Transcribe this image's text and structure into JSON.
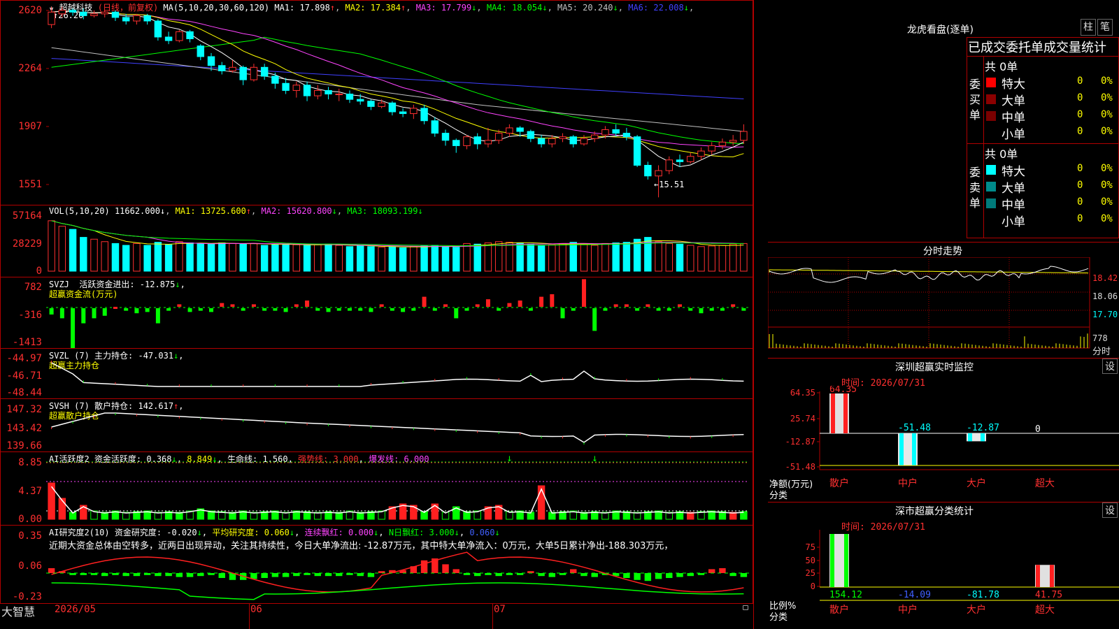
{
  "stock": {
    "name": "超越科技",
    "mode": "(日线，前复权)",
    "star": "★"
  },
  "main_ma": {
    "label": "MA(5,10,20,30,60,120)",
    "items": [
      {
        "label": "MA1: 17.898",
        "arrow": "↑",
        "color": "#ffffff"
      },
      {
        "label": "MA2: 17.384",
        "arrow": "↑",
        "color": "#ffff00"
      },
      {
        "label": "MA3: 17.799",
        "arrow": "↓",
        "color": "#ff44ff"
      },
      {
        "label": "MA4: 18.054",
        "arrow": "↓",
        "color": "#00ff00"
      },
      {
        "label": "MA5: 20.240",
        "arrow": "↓",
        "color": "#c0c0c0"
      },
      {
        "label": "MA6: 22.008",
        "arrow": "↓",
        "color": "#4040ff"
      }
    ],
    "high_mark": "↑26.20",
    "low_mark": "←15.51",
    "yticks": [
      "2620",
      "2264",
      "1907",
      "1551"
    ]
  },
  "vol": {
    "label": "VOL(5,10,20)",
    "value": "11662.000",
    "arrow": "↓",
    "ma1": "MA1: 13725.600",
    "ma1_arrow": "↑",
    "ma2": "MA2: 15620.800",
    "ma2_arrow": "↓",
    "ma3": "MA3: 18093.199",
    "ma3_arrow": "↓",
    "yticks": [
      "57164",
      "28229",
      "0"
    ]
  },
  "svzj": {
    "label": "SVZJ",
    "name": "活跃资金进出: -12.875",
    "arrow": "↓",
    "sub": "超赢资金流(万元)",
    "yticks": [
      "782",
      "-316",
      "-1413"
    ]
  },
  "svzl": {
    "label": "SVZL (7)",
    "name": "主力持仓: -47.031",
    "arrow": "↓",
    "sub": "超赢主力持仓",
    "yticks": [
      "-44.97",
      "-46.71",
      "-48.44"
    ]
  },
  "svsh": {
    "label": "SVSH (7)",
    "name": "散户持仓: 142.617",
    "arrow": "↑",
    "sub": "超赢散户持仓",
    "yticks": [
      "147.32",
      "143.42",
      "139.66"
    ]
  },
  "ai1": {
    "label": "AI活跃度2",
    "v1": "资金活跃度: 0.368",
    "v1a": "↓",
    "v2": "8.849",
    "v2a": "↓",
    "v3": "生命线: 1.560",
    "v4": "强势线: 3.000",
    "v5": "爆发线: 6.000",
    "yticks": [
      "8.85",
      "4.37",
      "0.00"
    ]
  },
  "ai2": {
    "label": "AI研究度2(10)",
    "v1": "资金研究度: -0.020",
    "v1a": "↓",
    "v2": "平均研究度: 0.060",
    "v2a": "↓",
    "v3": "连续飘红: 0.000",
    "v3a": "↓",
    "v4": "N日飘红: 3.000",
    "v4a": "↓",
    "v5": "0.060",
    "v5a": "↓",
    "desc": "近期大资金总体由空转多，近两日出现异动，关注其持续性，今日大单净流出: -12.87万元，其中特大单净流入：0万元，大单5日累计净出-188.303万元，",
    "yticks": [
      "0.35",
      "0.06",
      "-0.23"
    ]
  },
  "bottom": {
    "brand": "大智慧",
    "dates": [
      "2026/05",
      "06",
      "07"
    ]
  },
  "longhu": {
    "title": "龙虎看盘(逐单)",
    "btn1": "柱",
    "btn2": "笔",
    "header": "已成交委托单成交量统计",
    "buy_label": "委买单",
    "sell_label": "委卖单",
    "buy_total": "共 0单",
    "sell_total": "共 0单",
    "buy_rows": [
      {
        "name": "特大",
        "count": "0",
        "pct": "0%",
        "color": "#ff0000"
      },
      {
        "name": "大单",
        "count": "0",
        "pct": "0%",
        "color": "#8b0000"
      },
      {
        "name": "中单",
        "count": "0",
        "pct": "0%",
        "color": "#7a0000"
      },
      {
        "name": "小单",
        "count": "0",
        "pct": "0%",
        "color": "#000000"
      }
    ],
    "sell_rows": [
      {
        "name": "特大",
        "count": "0",
        "pct": "0%",
        "color": "#00ffff"
      },
      {
        "name": "大单",
        "count": "0",
        "pct": "0%",
        "color": "#008b8b"
      },
      {
        "name": "中单",
        "count": "0",
        "pct": "0%",
        "color": "#007a7a"
      },
      {
        "name": "小单",
        "count": "0",
        "pct": "0%",
        "color": "#000000"
      }
    ]
  },
  "fenshi": {
    "title": "分时走势",
    "p1": "18.42",
    "p2": "18.06",
    "p3": "17.70",
    "vol": "778",
    "vol_label": "分时"
  },
  "sz_monitor": {
    "title": "深圳超赢实时监控",
    "btn": "设",
    "time": "时间: 2026/07/31",
    "yticks": [
      "64.35",
      "25.74",
      "-12.87",
      "-51.48"
    ],
    "ylabel1": "净额(万元)",
    "ylabel2": "分类",
    "categories": [
      "散户",
      "中户",
      "大户",
      "超大"
    ],
    "values": [
      64.35,
      -51.48,
      -12.87,
      0
    ],
    "value_labels": [
      "64.35",
      "-51.48",
      "-12.87",
      "0"
    ]
  },
  "sz_class": {
    "title": "深市超赢分类统计",
    "btn": "设",
    "time": "时间: 2026/07/31",
    "yticks": [
      "75",
      "50",
      "25",
      "0"
    ],
    "ylabel1": "比例%",
    "ylabel2": "分类",
    "categories": [
      "散户",
      "中户",
      "大户",
      "超大"
    ],
    "values": [
      154.12,
      -14.09,
      -81.78,
      41.75
    ],
    "value_labels": [
      "154.12",
      "-14.09",
      "-81.78",
      "41.75"
    ]
  },
  "chart_data": {
    "type": "candlestick",
    "ylim": [
      15.2,
      26.5
    ],
    "candles": [
      [
        25.2,
        25.9,
        26.2,
        25.0
      ],
      [
        25.8,
        26.0,
        26.2,
        25.6
      ],
      [
        26.0,
        25.9,
        26.1,
        25.7
      ],
      [
        25.9,
        25.7,
        26.1,
        25.5
      ],
      [
        25.7,
        25.8,
        26.0,
        25.6
      ],
      [
        25.8,
        25.9,
        26.0,
        25.6
      ],
      [
        25.9,
        25.6,
        26.0,
        25.4
      ],
      [
        25.6,
        25.4,
        25.8,
        25.2
      ],
      [
        25.4,
        25.7,
        25.8,
        25.2
      ],
      [
        25.7,
        25.4,
        25.8,
        25.2
      ],
      [
        25.4,
        24.5,
        25.5,
        24.3
      ],
      [
        24.5,
        24.3,
        24.8,
        24.1
      ],
      [
        24.3,
        24.8,
        24.9,
        24.2
      ],
      [
        24.8,
        24.4,
        24.9,
        24.2
      ],
      [
        24.0,
        23.4,
        24.1,
        23.2
      ],
      [
        23.4,
        22.9,
        23.6,
        22.6
      ],
      [
        22.9,
        22.6,
        23.1,
        22.4
      ],
      [
        22.6,
        22.8,
        23.2,
        22.5
      ],
      [
        22.8,
        22.1,
        22.9,
        21.8
      ],
      [
        22.1,
        22.8,
        23.0,
        22.0
      ],
      [
        22.8,
        22.3,
        23.0,
        22.1
      ],
      [
        22.3,
        21.9,
        22.5,
        21.6
      ],
      [
        21.9,
        21.5,
        22.2,
        21.3
      ],
      [
        21.5,
        21.8,
        22.0,
        21.1
      ],
      [
        21.8,
        21.2,
        22.0,
        20.9
      ],
      [
        21.2,
        21.5,
        21.8,
        21.0
      ],
      [
        21.5,
        21.3,
        21.7,
        21.0
      ],
      [
        21.3,
        21.3,
        21.6,
        20.9
      ],
      [
        21.3,
        21.0,
        21.5,
        20.8
      ],
      [
        21.0,
        20.9,
        21.3,
        20.7
      ],
      [
        20.9,
        20.6,
        21.0,
        20.4
      ],
      [
        20.6,
        20.8,
        21.0,
        20.5
      ],
      [
        20.8,
        20.3,
        20.9,
        20.1
      ],
      [
        20.3,
        20.2,
        20.5,
        20.0
      ],
      [
        20.2,
        20.5,
        20.7,
        19.9
      ],
      [
        20.5,
        19.8,
        20.7,
        19.6
      ],
      [
        19.8,
        19.1,
        20.0,
        18.9
      ],
      [
        19.1,
        18.7,
        19.3,
        18.4
      ],
      [
        18.7,
        18.4,
        18.8,
        18.0
      ],
      [
        18.4,
        18.9,
        19.0,
        18.2
      ],
      [
        18.9,
        18.5,
        19.1,
        18.2
      ],
      [
        18.5,
        18.7,
        19.4,
        18.3
      ],
      [
        18.7,
        19.1,
        19.3,
        18.5
      ],
      [
        19.1,
        19.4,
        19.6,
        18.9
      ],
      [
        19.4,
        19.2,
        19.5,
        18.9
      ],
      [
        19.2,
        18.8,
        19.3,
        18.6
      ],
      [
        18.8,
        18.5,
        19.0,
        18.3
      ],
      [
        18.5,
        18.8,
        19.0,
        18.3
      ],
      [
        18.8,
        18.9,
        19.1,
        18.6
      ],
      [
        18.9,
        18.5,
        19.0,
        18.3
      ],
      [
        18.5,
        18.8,
        19.0,
        18.4
      ],
      [
        18.8,
        19.0,
        19.2,
        18.6
      ],
      [
        19.0,
        19.3,
        19.5,
        18.8
      ],
      [
        19.3,
        19.1,
        19.6,
        18.9
      ],
      [
        19.1,
        18.9,
        19.4,
        18.7
      ],
      [
        18.9,
        17.3,
        19.0,
        17.2
      ],
      [
        17.3,
        16.7,
        17.5,
        16.5
      ],
      [
        16.7,
        17.0,
        17.3,
        15.5
      ],
      [
        17.0,
        17.6,
        17.8,
        16.8
      ],
      [
        17.6,
        17.5,
        17.9,
        17.2
      ],
      [
        17.5,
        17.8,
        18.0,
        17.4
      ],
      [
        17.8,
        18.1,
        18.3,
        17.6
      ],
      [
        18.1,
        18.4,
        18.6,
        17.9
      ],
      [
        18.4,
        18.6,
        18.8,
        18.2
      ],
      [
        18.6,
        18.7,
        19.0,
        18.4
      ],
      [
        18.7,
        19.2,
        19.6,
        18.5
      ]
    ]
  }
}
